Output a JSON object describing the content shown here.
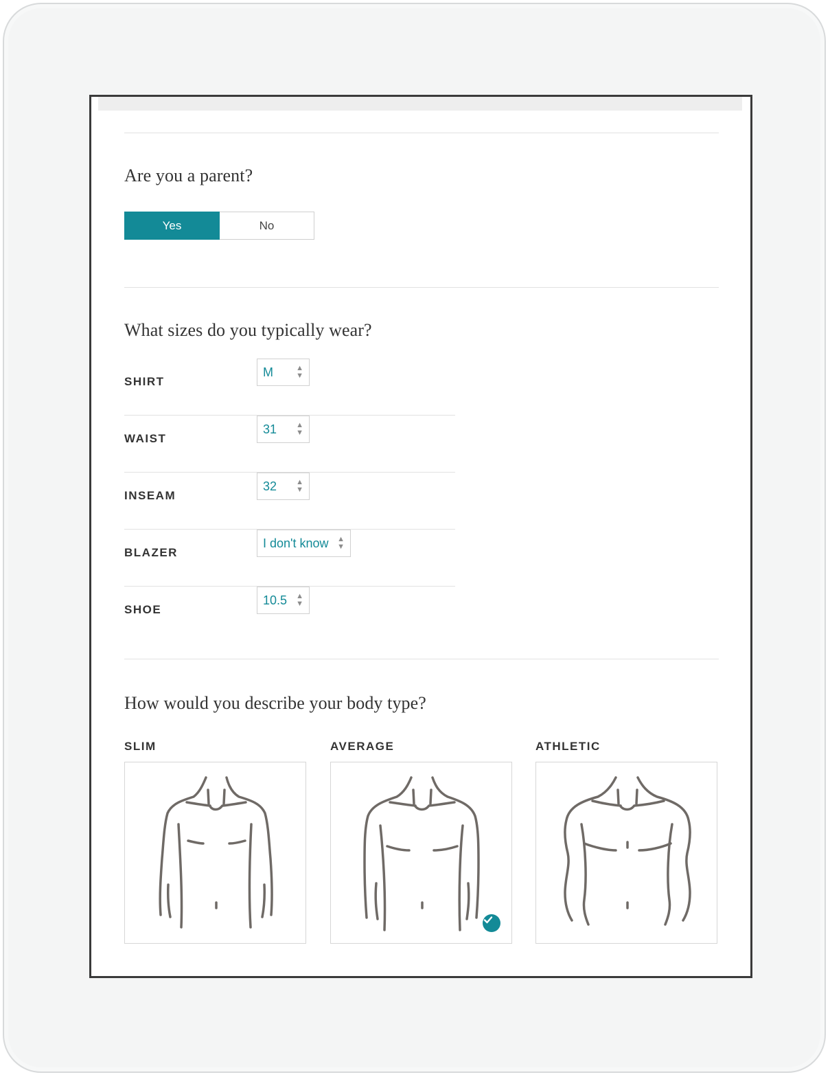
{
  "parent_section": {
    "question": "Are you a parent?",
    "options": [
      "Yes",
      "No"
    ],
    "selected": "Yes"
  },
  "sizes_section": {
    "question": "What sizes do you typically wear?",
    "rows": [
      {
        "label": "SHIRT",
        "value": "M"
      },
      {
        "label": "WAIST",
        "value": "31"
      },
      {
        "label": "INSEAM",
        "value": "32"
      },
      {
        "label": "BLAZER",
        "value": "I don't know"
      },
      {
        "label": "SHOE",
        "value": "10.5"
      }
    ]
  },
  "body_section": {
    "question": "How would you describe your body type?",
    "options": [
      {
        "label": "SLIM",
        "icon": "slim-torso-icon"
      },
      {
        "label": "AVERAGE",
        "icon": "average-torso-icon"
      },
      {
        "label": "ATHLETIC",
        "icon": "athletic-torso-icon"
      }
    ],
    "selected": "AVERAGE"
  },
  "colors": {
    "accent": "#138a97",
    "line_art": "#6f6a66"
  }
}
